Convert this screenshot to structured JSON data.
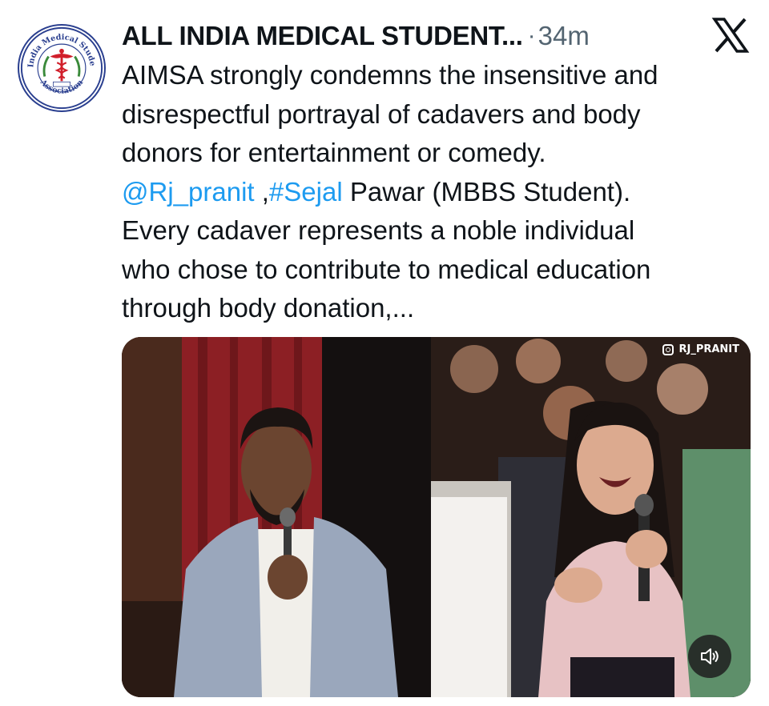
{
  "author": {
    "display_name": "ALL INDIA MEDICAL STUDENT...",
    "separator": "·",
    "time": "34m",
    "avatar_text": {
      "ring_top": "All India Medical Students'",
      "ring_bottom": "Association"
    }
  },
  "tweet": {
    "line1": "AIMSA strongly condemns the insensitive and",
    "line2": "disrespectful portrayal of cadavers and body",
    "line3": "donors for entertainment or comedy.",
    "mention": "@Rj_pranit",
    "mention_sep": " ,",
    "hashtag": "#Sejal",
    "line4_rest": " Pawar (MBBS Student).",
    "line5": "Every cadaver represents a noble individual",
    "line6": "who chose to contribute to medical education",
    "line7": "through body donation,..."
  },
  "media": {
    "watermark": "RJ_PRANIT",
    "watermark_icon": "instagram-icon",
    "mute_icon": "speaker-icon"
  },
  "icons": {
    "platform": "x-logo-icon"
  },
  "colors": {
    "link": "#1d9bf0",
    "text": "#0f1419",
    "secondary": "#536471",
    "avatar_ring": "#2a3f8f",
    "avatar_caduceus": "#d11f2b"
  }
}
